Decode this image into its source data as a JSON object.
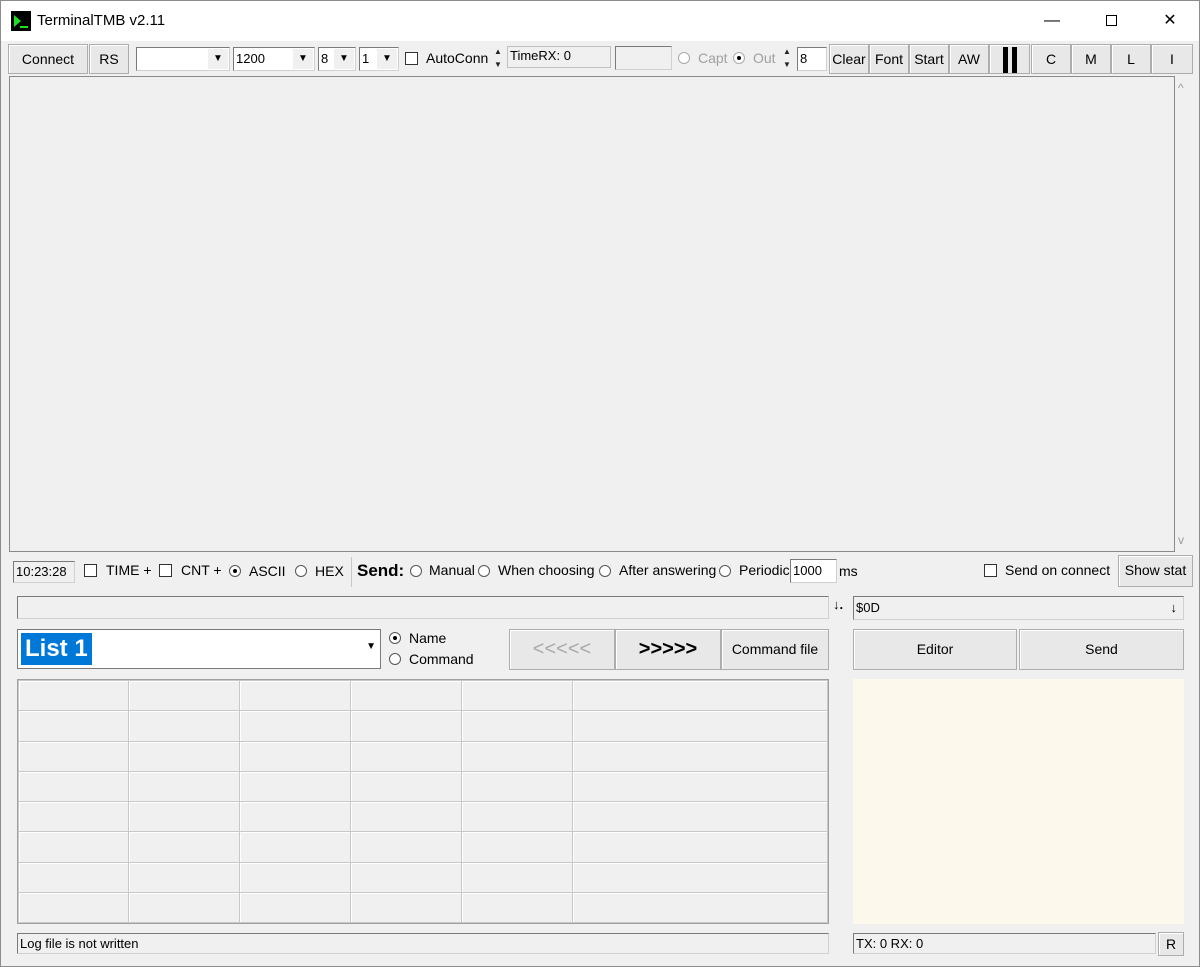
{
  "window": {
    "title": "TerminalTMB v2.11",
    "minimize": "—",
    "close": "✕"
  },
  "toolbar": {
    "connect": "Connect",
    "rs": "RS",
    "port": "",
    "baud": "1200",
    "databits": "8",
    "stopbits": "1",
    "autoconn": "AutoConn",
    "timerx": "TimeRX: 0",
    "capt": "Capt",
    "out": "Out",
    "out_count": "8",
    "clear": "Clear",
    "font": "Font",
    "start": "Start",
    "aw": "AW",
    "c": "C",
    "m": "M",
    "l": "L",
    "i": "I"
  },
  "statusbar": {
    "time": "10:23:28",
    "time_plus": "TIME +",
    "cnt_plus": "CNT +",
    "ascii": "ASCII",
    "hex": "HEX",
    "send_label": "Send:",
    "manual": "Manual",
    "when_choosing": "When choosing",
    "after_answering": "After answering",
    "periodic": "Periodic",
    "period_value": "1000",
    "ms": "ms",
    "send_on_connect": "Send on connect",
    "show_stat": "Show stat"
  },
  "command": {
    "input": "",
    "arrow": "↓.",
    "terminator": "$0D",
    "terminator_arrow": "↓"
  },
  "list": {
    "selected": "List 1",
    "name": "Name",
    "command": "Command",
    "prev": "<<<<<",
    "next": ">>>>>",
    "command_file": "Command file",
    "editor": "Editor",
    "send": "Send"
  },
  "footer": {
    "log": "Log file is not written",
    "txrx": "TX: 0 RX: 0",
    "r": "R"
  },
  "icons": [
    "terminal-app-icon",
    "dropdown-arrow-icon",
    "spin-arrows-icon",
    "pause-icon"
  ]
}
